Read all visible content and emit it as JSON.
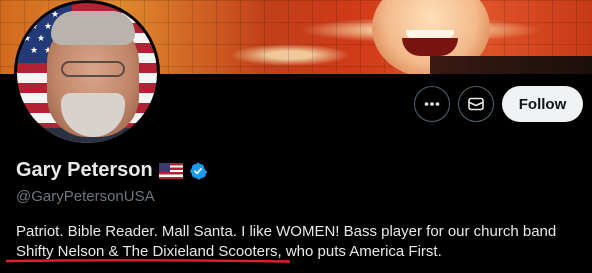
{
  "profile": {
    "display_name": "Gary Peterson",
    "handle": "@GaryPetersonUSA",
    "bio_line1": "Patriot. Bible Reader. Mall Santa. I like WOMEN! Bass player for our church band",
    "bio_line2": "Shifty Nelson & The Dixieland Scooters, who puts America First."
  },
  "actions": {
    "follow_label": "Follow",
    "more_icon": "more-horizontal-icon",
    "message_icon": "envelope-icon"
  },
  "colors": {
    "background": "#000000",
    "verified": "#1d9bf0",
    "annotation_underline": "#e0202a",
    "follow_bg": "#eff3f4",
    "secondary_text": "#71767b"
  }
}
